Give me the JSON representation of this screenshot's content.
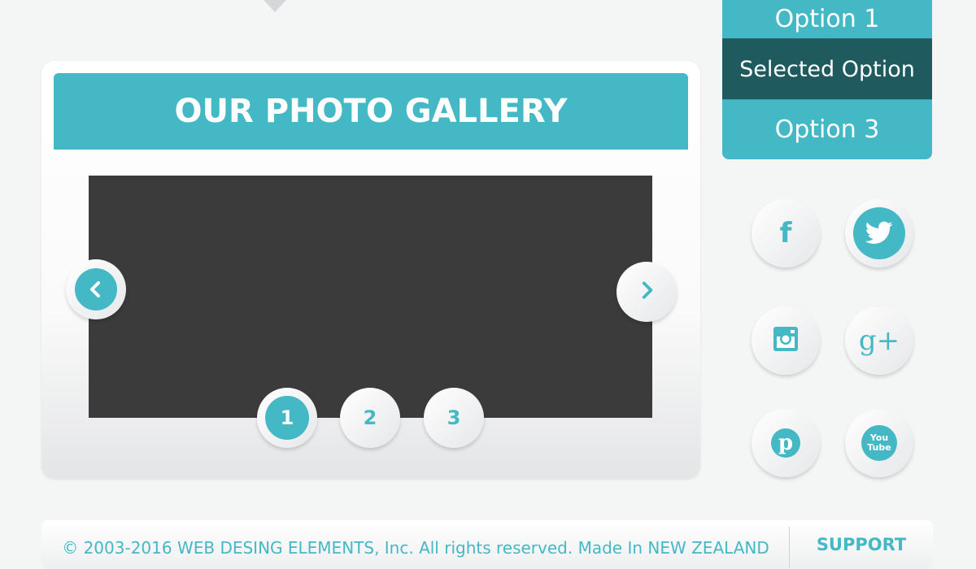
{
  "gallery": {
    "title": "OUR PHOTO GALLERY",
    "pages": [
      "1",
      "2",
      "3"
    ],
    "active_page": 1,
    "prev_icon": "chevron-left-icon",
    "next_icon": "chevron-right-icon"
  },
  "dropdown": {
    "options": [
      "Option 1",
      "Selected Option",
      "Option 3"
    ],
    "selected_index": 1
  },
  "social": [
    {
      "name": "facebook",
      "glyph": "f"
    },
    {
      "name": "twitter",
      "glyph": "🐦"
    },
    {
      "name": "instagram",
      "glyph": ""
    },
    {
      "name": "google-plus",
      "glyph": "g+"
    },
    {
      "name": "pinterest",
      "glyph": "p"
    },
    {
      "name": "youtube",
      "glyph": "You Tube"
    }
  ],
  "footer": {
    "copyright": "© 2003-2016 WEB DESING ELEMENTS, Inc. All rights reserved. Made In NEW ZEALAND",
    "support": "SUPPORT"
  },
  "colors": {
    "accent": "#44b8c5",
    "selected": "#1f5a5e",
    "photo": "#3b3b3b",
    "background": "#f4f6f6"
  }
}
